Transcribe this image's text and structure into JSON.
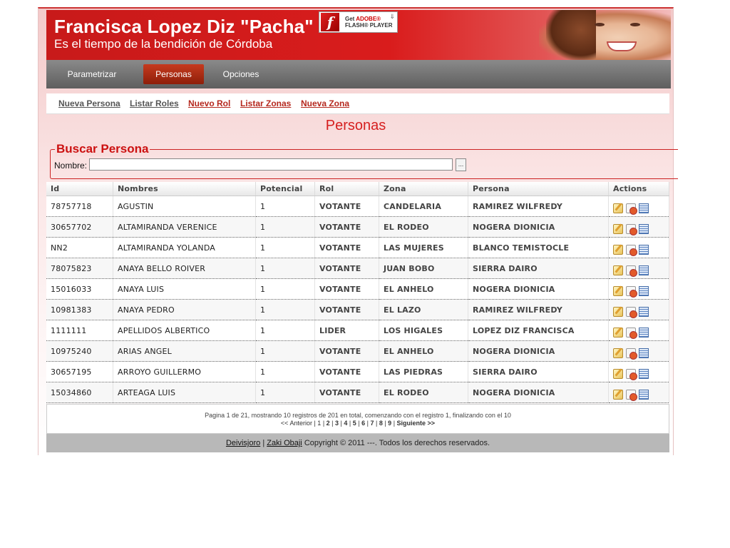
{
  "header": {
    "title": "Francisca Lopez Diz \"Pacha\"",
    "subtitle": "Es el tiempo de la bendición de Córdoba",
    "flash": {
      "line1": "Get",
      "adobe": "ADOBE®",
      "line2": "FLASH® PLAYER",
      "logo": "f"
    }
  },
  "nav": {
    "items": [
      "Parametrizar",
      "Personas",
      "Opciones"
    ],
    "active": "Personas"
  },
  "subnav": {
    "links": [
      "Nueva Persona",
      "Listar Roles",
      "Nuevo Rol",
      "Listar Zonas",
      "Nueva Zona"
    ]
  },
  "page_title": "Personas",
  "search": {
    "legend": "Buscar Persona",
    "label": "Nombre:",
    "value": "",
    "button": "..."
  },
  "table": {
    "columns": [
      "Id",
      "Nombres",
      "Potencial",
      "Rol",
      "Zona",
      "Persona",
      "Actions"
    ],
    "rows": [
      [
        "78757718",
        "AGUSTIN",
        "1",
        "VOTANTE",
        "CANDELARIA",
        "RAMIREZ WILFREDY"
      ],
      [
        "30657702",
        "ALTAMIRANDA VERENICE",
        "1",
        "VOTANTE",
        "EL RODEO",
        "NOGERA DIONICIA"
      ],
      [
        "NN2",
        "ALTAMIRANDA YOLANDA",
        "1",
        "VOTANTE",
        "LAS MUJERES",
        "BLANCO TEMISTOCLE"
      ],
      [
        "78075823",
        "ANAYA BELLO ROIVER",
        "1",
        "VOTANTE",
        "JUAN BOBO",
        "SIERRA DAIRO"
      ],
      [
        "15016033",
        "ANAYA LUIS",
        "1",
        "VOTANTE",
        "EL ANHELO",
        "NOGERA DIONICIA"
      ],
      [
        "10981383",
        "ANAYA PEDRO",
        "1",
        "VOTANTE",
        "EL LAZO",
        "RAMIREZ WILFREDY"
      ],
      [
        "1111111",
        "APELLIDOS ALBERTICO",
        "1",
        "LIDER",
        "LOS HIGALES",
        "LOPEZ DIZ FRANCISCA"
      ],
      [
        "10975240",
        "ARIAS ANGEL",
        "1",
        "VOTANTE",
        "EL ANHELO",
        "NOGERA DIONICIA"
      ],
      [
        "30657195",
        "ARROYO GUILLERMO",
        "1",
        "VOTANTE",
        "LAS PIEDRAS",
        "SIERRA DAIRO"
      ],
      [
        "15034860",
        "ARTEAGA LUIS",
        "1",
        "VOTANTE",
        "EL RODEO",
        "NOGERA DIONICIA"
      ]
    ],
    "action_icons": [
      "edit-icon",
      "delete-icon",
      "view-icon"
    ]
  },
  "pager": {
    "summary": "Pagina 1 de 21, mostrando 10 registros de 201 en total, comenzando con el registro 1, finalizando con el 10",
    "prev": "<< Anterior",
    "pages": [
      "1",
      "2",
      "3",
      "4",
      "5",
      "6",
      "7",
      "8",
      "9"
    ],
    "next": "Siguiente >>"
  },
  "footer": {
    "link1": "Deivisjoro",
    "sep": "|",
    "link2": "Zaki Obaji",
    "text": "Copyright © 2011 ---. Todos los derechos reservados."
  },
  "colors": {
    "brand_red": "#d61f1f",
    "nav_gray": "#6e6e6e",
    "active_tab": "#a82a12"
  }
}
